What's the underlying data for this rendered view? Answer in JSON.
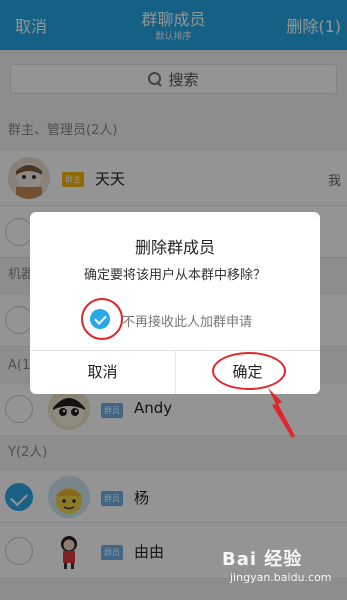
{
  "header": {
    "left": "取消",
    "title": "群聊成员",
    "subtitle": "默认排序",
    "right": "删除(1)"
  },
  "search": {
    "label": "搜索"
  },
  "sections": [
    {
      "label": "群主、管理员(2人)"
    },
    {
      "label": "机器"
    },
    {
      "label": "A(1"
    },
    {
      "label": "Y(2人)"
    }
  ],
  "members": [
    {
      "name": "天天",
      "badge": "群主",
      "side": "我",
      "checked": false
    },
    {
      "name": "Andy",
      "badge": "群员",
      "checked": false
    },
    {
      "name": "杨",
      "badge": "群员",
      "checked": true
    },
    {
      "name": "由由",
      "badge": "群员",
      "checked": false
    }
  ],
  "dialog": {
    "title": "删除群成员",
    "message": "确定要将该用户从本群中移除？",
    "checkbox_label": "不再接收此人加群申请",
    "checkbox_checked": true,
    "cancel": "取消",
    "confirm": "确定"
  },
  "watermark": {
    "main": "Bai 经验",
    "sub": "jingyan.baidu.com"
  },
  "colors": {
    "accent": "#25a8e6",
    "annotation": "#e0252b"
  }
}
